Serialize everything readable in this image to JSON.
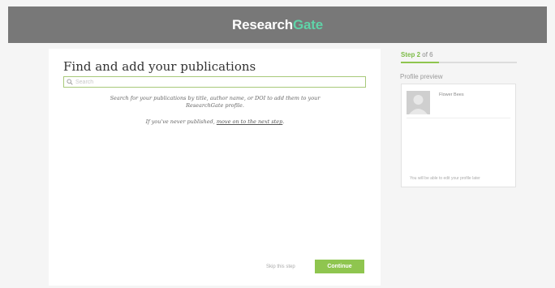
{
  "header": {
    "logo_part1": "Research",
    "logo_part2": "Gate"
  },
  "main": {
    "title": "Find and add your publications",
    "search_placeholder": "Search",
    "help_line1": "Search for your publications by title, author name, or DOI to add them to your",
    "help_line2": "ResearchGate profile.",
    "never_text": "If you've never published, ",
    "never_link": "move on to the next step",
    "never_end": ".",
    "skip_label": "Skip this step",
    "continue_label": "Continue"
  },
  "sidebar": {
    "step_label": "Step",
    "step_current": "2",
    "step_of": "of 6",
    "progress": 0.33,
    "preview_label": "Profile preview",
    "card_name": "Flower Bees",
    "card_note": "You will be able to edit your profile later"
  },
  "colors": {
    "accent": "#8fc54f",
    "header_bg": "#787878",
    "logo_accent": "#5fd3a8"
  }
}
